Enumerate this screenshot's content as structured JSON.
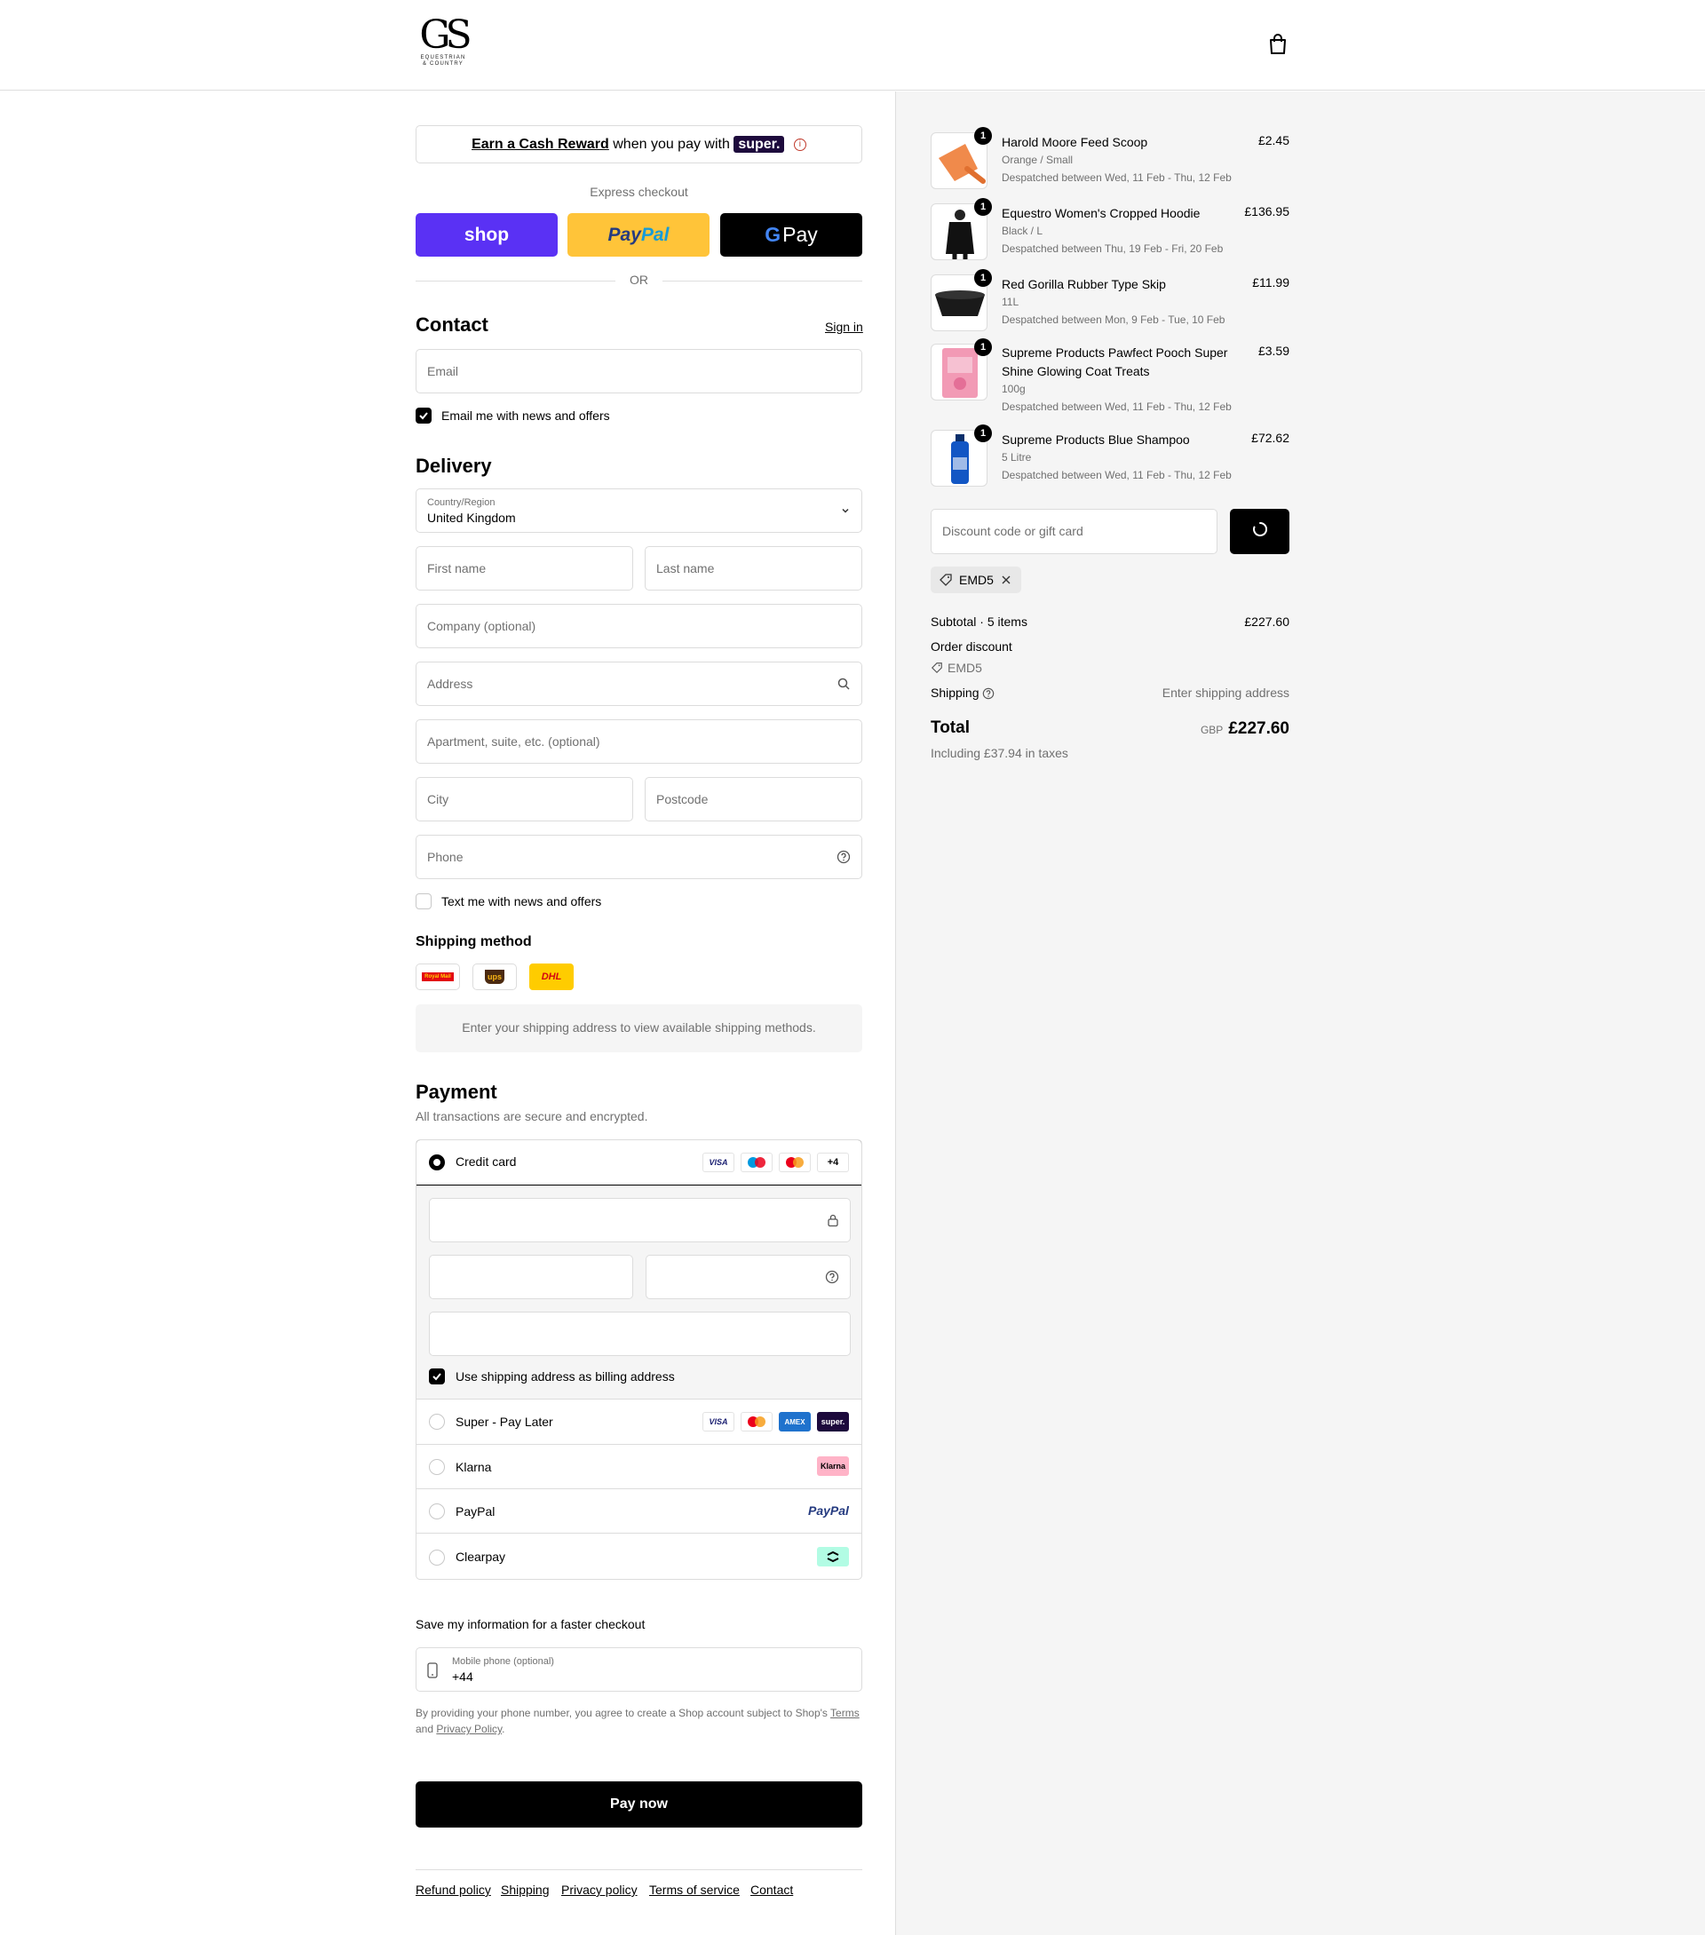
{
  "header": {
    "logo_monogram": "GS",
    "logo_line1": "EQUESTRIAN",
    "logo_line2": "& COUNTRY"
  },
  "promo": {
    "link": "Earn a Cash Reward",
    "text": " when you pay with ",
    "brand": "super."
  },
  "express": {
    "label": "Express checkout",
    "shop": "shop",
    "paypal_a": "Pay",
    "paypal_b": "Pal",
    "gpay_g": "G",
    "gpay": "Pay",
    "or": "OR"
  },
  "contact": {
    "title": "Contact",
    "sign_in": "Sign in",
    "email_placeholder": "Email",
    "news_label": "Email me with news and offers"
  },
  "delivery": {
    "title": "Delivery",
    "country_label": "Country/Region",
    "country_value": "United Kingdom",
    "first_name": "First name",
    "last_name": "Last name",
    "company": "Company (optional)",
    "address": "Address",
    "apartment": "Apartment, suite, etc. (optional)",
    "city": "City",
    "postcode": "Postcode",
    "phone": "Phone",
    "text_label": "Text me with news and offers"
  },
  "shipping": {
    "title": "Shipping method",
    "carriers": [
      "Royal Mail",
      "ups",
      "DHL"
    ],
    "notice": "Enter your shipping address to view available shipping methods."
  },
  "payment": {
    "title": "Payment",
    "subtitle": "All transactions are secure and encrypted.",
    "credit_card": "Credit card",
    "card_more": "+4",
    "billing_label": "Use shipping address as billing address",
    "methods": [
      {
        "label": "Super - Pay Later"
      },
      {
        "label": "Klarna"
      },
      {
        "label": "PayPal"
      },
      {
        "label": "Clearpay"
      }
    ],
    "icons": {
      "visa": "VISA",
      "amex": "AMEX",
      "super": "super.",
      "klarna": "Klarna",
      "paypal": "PayPal"
    }
  },
  "save_info": {
    "title": "Save my information for a faster checkout",
    "mobile_label": "Mobile phone (optional)",
    "mobile_value": "+44",
    "legal_a": "By providing your phone number, you agree to create a Shop account subject to Shop's ",
    "terms": "Terms",
    "legal_b": "and ",
    "privacy": "Privacy Policy",
    "legal_c": "."
  },
  "pay_now": "Pay now",
  "footer": [
    "Refund policy",
    "Shipping",
    "Privacy policy",
    "Terms of service",
    "Contact"
  ],
  "order": {
    "items": [
      {
        "name": "Harold Moore Feed Scoop",
        "variant": "Orange / Small",
        "dispatch": "Despatched between Wed, 11 Feb - Thu, 12 Feb",
        "price": "£2.45",
        "qty": "1"
      },
      {
        "name": "Equestro Women's Cropped Hoodie",
        "variant": "Black / L",
        "dispatch": "Despatched between Thu, 19 Feb - Fri, 20 Feb",
        "price": "£136.95",
        "qty": "1"
      },
      {
        "name": "Red Gorilla Rubber Type Skip",
        "variant": "11L",
        "dispatch": "Despatched between Mon, 9 Feb - Tue, 10 Feb",
        "price": "£11.99",
        "qty": "1"
      },
      {
        "name": "Supreme Products Pawfect Pooch Super Shine Glowing Coat Treats",
        "variant": "100g",
        "dispatch": "Despatched between Wed, 11 Feb - Thu, 12 Feb",
        "price": "£3.59",
        "qty": "1"
      },
      {
        "name": "Supreme Products Blue Shampoo",
        "variant": "5 Litre",
        "dispatch": "Despatched between Wed, 11 Feb - Thu, 12 Feb",
        "price": "£72.62",
        "qty": "1"
      }
    ],
    "discount_placeholder": "Discount code or gift card",
    "code_chip": "EMD5",
    "subtotal_label": "Subtotal · 5 items",
    "subtotal_value": "£227.60",
    "order_discount_label": "Order discount",
    "order_discount_code": "EMD5",
    "shipping_label": "Shipping",
    "shipping_value": "Enter shipping address",
    "total_label": "Total",
    "currency": "GBP",
    "total_value": "£227.60",
    "taxes": "Including £37.94 in taxes"
  }
}
